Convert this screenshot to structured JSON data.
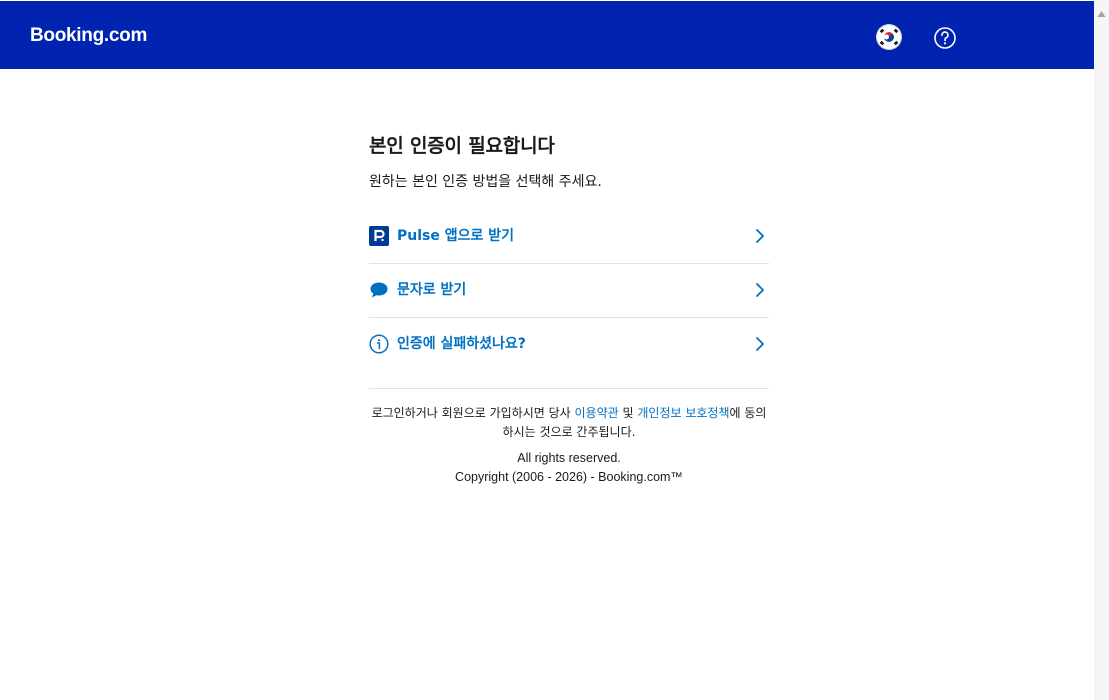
{
  "header": {
    "logo": "Booking.com",
    "language_icon": "korea-flag-icon",
    "help_icon": "help-circle-icon",
    "brand_color": "#0024b0"
  },
  "main": {
    "title": "본인 인증이 필요합니다",
    "subtitle": "원하는 본인 인증 방법을 선택해 주세요.",
    "options": [
      {
        "label": "Pulse 앱으로 받기",
        "icon": "pulse-app-icon"
      },
      {
        "label": "문자로 받기",
        "icon": "chat-bubble-icon"
      },
      {
        "label": "인증에 실패하셨나요?",
        "icon": "info-circle-icon"
      }
    ],
    "link_color": "#0071c2"
  },
  "footer": {
    "terms_prefix": "로그인하거나 회원으로 가입하시면 당사 ",
    "terms_link": "이용약관",
    "terms_and": " 및 ",
    "privacy_link": "개인정보 보호정책",
    "terms_suffix": "에 동의하시는 것으로 간주됩니다.",
    "rights": "All rights reserved.",
    "copyright": "Copyright (2006 - 2026) - Booking.com™"
  }
}
